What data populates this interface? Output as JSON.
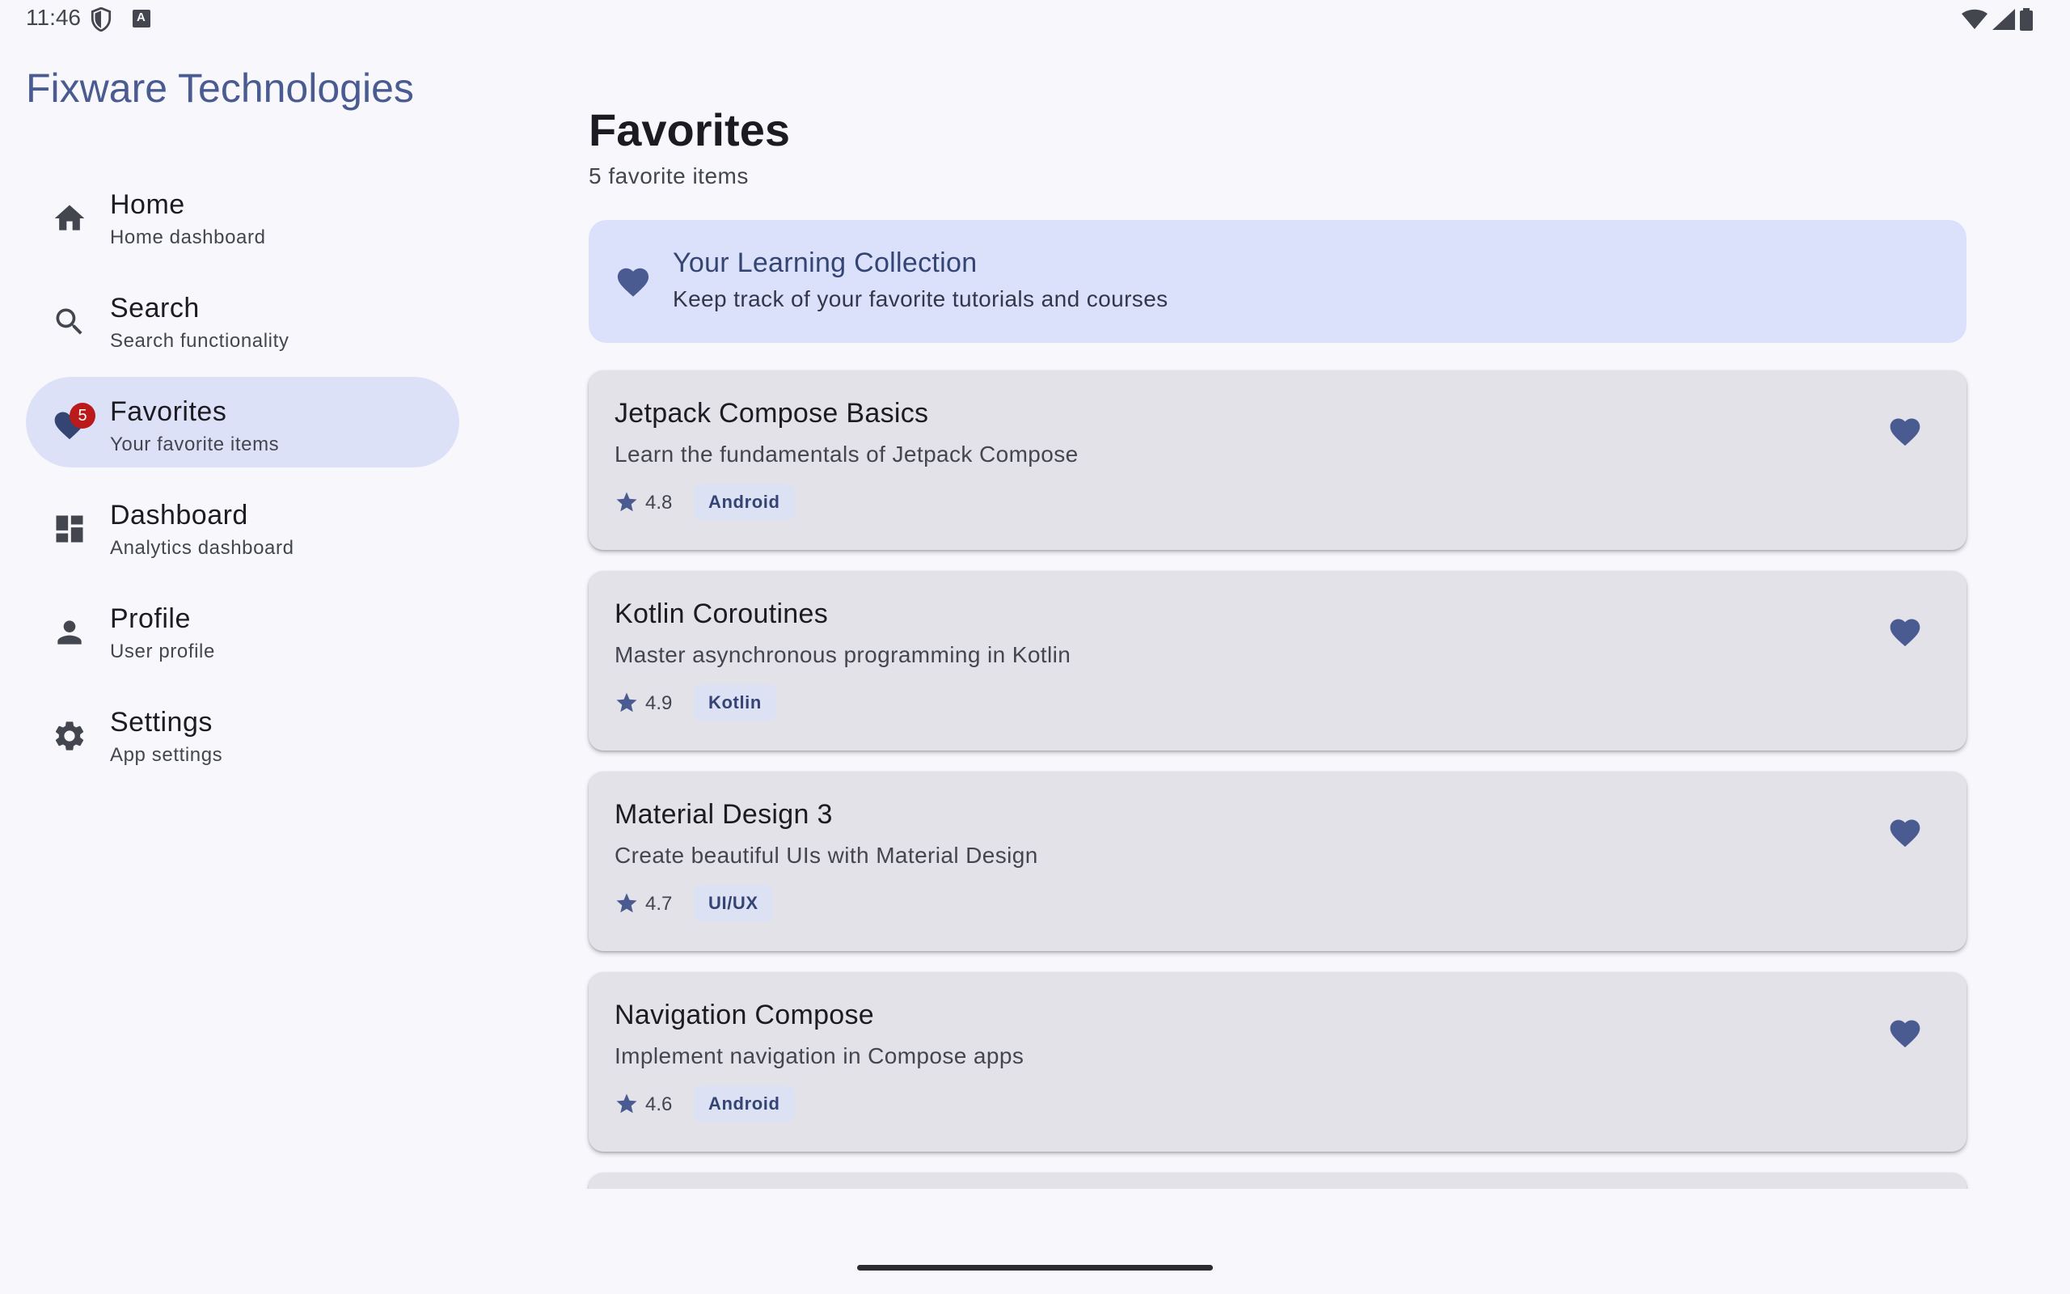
{
  "status_bar": {
    "time": "11:46"
  },
  "drawer": {
    "app_title": "Fixware Technologies",
    "items": [
      {
        "label": "Home",
        "subtitle": "Home dashboard",
        "icon": "home-icon"
      },
      {
        "label": "Search",
        "subtitle": "Search functionality",
        "icon": "search-icon"
      },
      {
        "label": "Favorites",
        "subtitle": "Your favorite items",
        "icon": "heart-icon",
        "badge": "5",
        "selected": true
      },
      {
        "label": "Dashboard",
        "subtitle": "Analytics dashboard",
        "icon": "dashboard-icon"
      },
      {
        "label": "Profile",
        "subtitle": "User profile",
        "icon": "person-icon"
      },
      {
        "label": "Settings",
        "subtitle": "App settings",
        "icon": "gear-icon"
      }
    ]
  },
  "main": {
    "title": "Favorites",
    "subtitle": "5 favorite items",
    "banner": {
      "title": "Your Learning Collection",
      "subtitle": "Keep track of your favorite tutorials and courses",
      "icon": "heart-icon"
    },
    "cards": [
      {
        "title": "Jetpack Compose Basics",
        "description": "Learn the fundamentals of Jetpack Compose",
        "rating": "4.8",
        "tag": "Android"
      },
      {
        "title": "Kotlin Coroutines",
        "description": "Master asynchronous programming in Kotlin",
        "rating": "4.9",
        "tag": "Kotlin"
      },
      {
        "title": "Material Design 3",
        "description": "Create beautiful UIs with Material Design",
        "rating": "4.7",
        "tag": "UI/UX"
      },
      {
        "title": "Navigation Compose",
        "description": "Implement navigation in Compose apps",
        "rating": "4.6",
        "tag": "Android"
      }
    ]
  },
  "colors": {
    "background": "#f8f8fc",
    "primary": "#4a5b92",
    "selected_nav": "#dce1f8",
    "banner": "#dbe1fb",
    "card": "#e3e2e9",
    "badge": "#ba1a1a"
  }
}
